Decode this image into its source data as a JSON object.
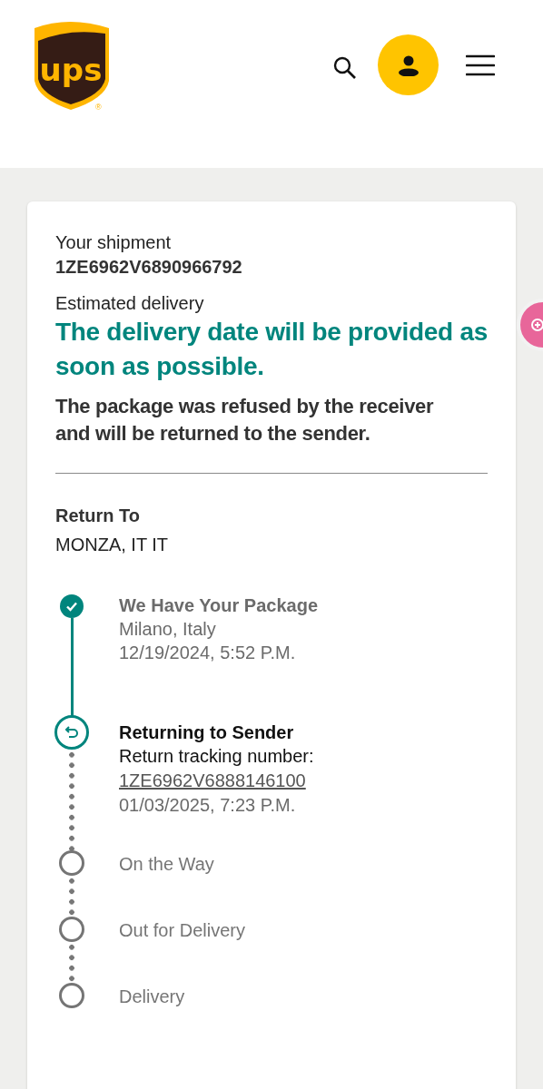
{
  "header": {
    "logo_text": "ups",
    "logo_mark": "®"
  },
  "shipment": {
    "label": "Your shipment",
    "tracking_number": "1ZE6962V6890966792",
    "estimate_label": "Estimated delivery",
    "estimate": "The delivery date will be provided as soon as possible.",
    "status_message": "The package was refused by the receiver and will be returned to the sender."
  },
  "return_to": {
    "label": "Return To",
    "value": "MONZA, IT IT"
  },
  "steps": [
    {
      "kind": "done",
      "title": "We Have Your Package",
      "lines": [
        "Milano, Italy",
        "12/19/2024, 5:52 P.M."
      ]
    },
    {
      "kind": "current",
      "title": "Returning to Sender",
      "lines": [
        "Return tracking number:"
      ],
      "link": "1ZE6962V6888146100",
      "date": "01/03/2025, 7:23 P.M."
    },
    {
      "kind": "pending",
      "title": "On the Way"
    },
    {
      "kind": "pending",
      "title": "Out for Delivery"
    },
    {
      "kind": "pending",
      "title": "Delivery"
    }
  ]
}
